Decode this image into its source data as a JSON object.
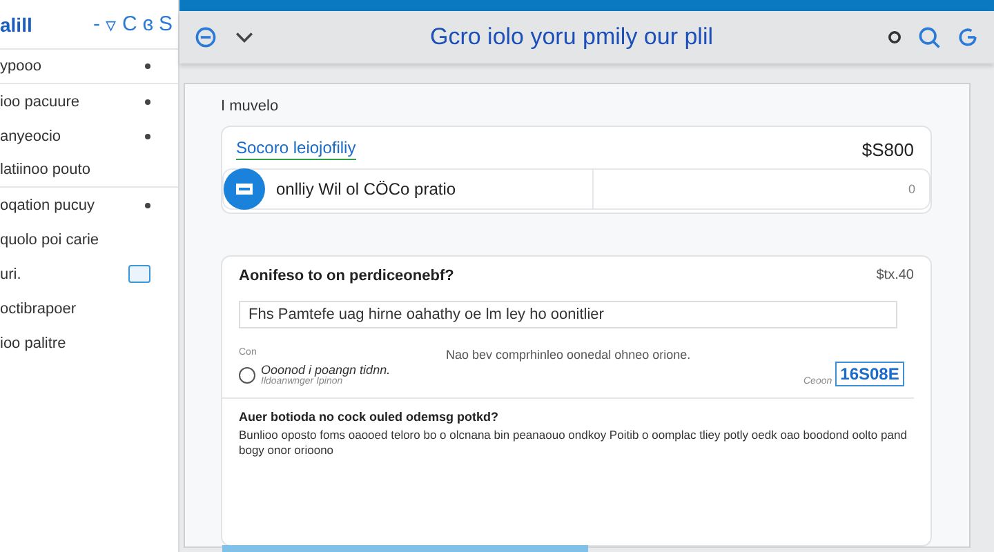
{
  "sidebar": {
    "title": "alill",
    "tools": [
      "-",
      "▿",
      "C",
      "ɞ",
      "S"
    ],
    "items": [
      {
        "label": "ypooo",
        "dot": true,
        "badge": false,
        "divider_after": true
      },
      {
        "label": "ioo pacuure",
        "dot": true,
        "badge": false,
        "divider_after": false
      },
      {
        "label": "anyeocio",
        "dot": true,
        "badge": false,
        "divider_after": false
      },
      {
        "label": "latiinoo pouto",
        "dot": false,
        "badge": false,
        "divider_after": true
      },
      {
        "label": "oqation pucuy",
        "dot": true,
        "badge": false,
        "divider_after": false
      },
      {
        "label": "quolo poi carie",
        "dot": false,
        "badge": false,
        "divider_after": false
      },
      {
        "label": "uri.",
        "dot": false,
        "badge": true,
        "divider_after": false
      },
      {
        "label": "octibrapoer",
        "dot": false,
        "badge": false,
        "divider_after": false
      },
      {
        "label": "ioo palitre",
        "dot": false,
        "badge": false,
        "divider_after": false
      }
    ]
  },
  "toolbar": {
    "title": "Gcro iolo yoru pmily our plil"
  },
  "section_label": "I muvelo",
  "summary_card": {
    "title": "Socoro leiojofiliy",
    "amount": "$S800",
    "row_text": "onlliy Wil ol CÖCo pratio",
    "row_value": "0"
  },
  "question_card": {
    "title": "Aonifeso to on perdiceonebf?",
    "amount": "$tx.40",
    "input_value": "Fhs Pamtefe uag hirne oahathy oe lm ley ho oonitlier",
    "option_label": "Con",
    "option_note": "Nao bev comprhinleo oonedal ohneo orione.",
    "radio": {
      "label": "Ooonod i poangn tidnn.",
      "sublabel": "Ildoanwnger Ipinon",
      "selected": false
    },
    "code_field": {
      "label": "Ceoon",
      "value": "16S08E"
    },
    "followup_title": "Auer botioda no cock ouled odemsg potkd?",
    "followup_text": "Bunlioo oposto foms oaooed teloro bo o olcnana bin peanaouo ondkoy Poitib o oomplac tliey potly oedk oao boodond oolto pand bogy onor orioono"
  }
}
